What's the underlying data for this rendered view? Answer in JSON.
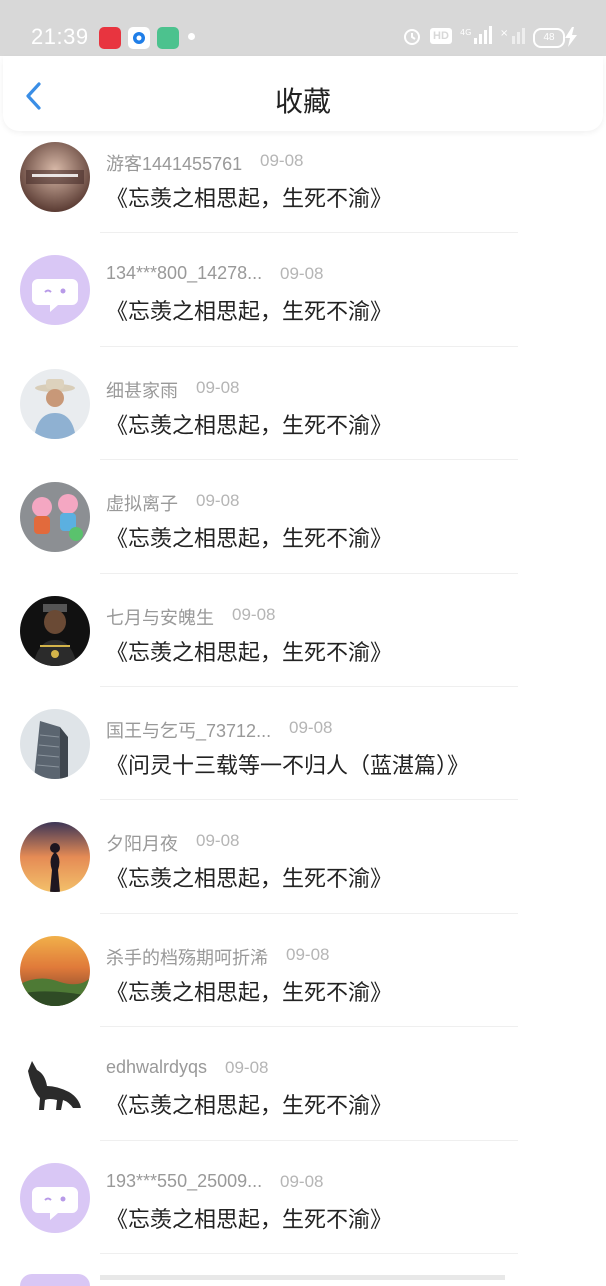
{
  "status_bar": {
    "time": "21:39",
    "hd_label": "HD",
    "battery": "48"
  },
  "header": {
    "title": "收藏"
  },
  "favorites": [
    {
      "user": "游客1441455761",
      "date": "09-08",
      "title": "《忘羡之相思起，生死不渝》",
      "avatar": "photo-dark-brown"
    },
    {
      "user": "134***800_14278...",
      "date": "09-08",
      "title": "《忘羡之相思起，生死不渝》",
      "avatar": "default-purple"
    },
    {
      "user": "细甚家雨",
      "date": "09-08",
      "title": "《忘羡之相思起，生死不渝》",
      "avatar": "photo-man-hat"
    },
    {
      "user": "虚拟离子",
      "date": "09-08",
      "title": "《忘羡之相思起，生死不渝》",
      "avatar": "photo-pig-toys"
    },
    {
      "user": "七月与安魄生",
      "date": "09-08",
      "title": "《忘羡之相思起，生死不渝》",
      "avatar": "photo-dark-figure"
    },
    {
      "user": "国王与乞丐_73712...",
      "date": "09-08",
      "title": "《问灵十三载等一不归人（蓝湛篇）》",
      "avatar": "photo-building"
    },
    {
      "user": "夕阳月夜",
      "date": "09-08",
      "title": "《忘羡之相思起，生死不渝》",
      "avatar": "photo-sunset"
    },
    {
      "user": "杀手的档殇期呵折浠",
      "date": "09-08",
      "title": "《忘羡之相思起，生死不渝》",
      "avatar": "photo-landscape"
    },
    {
      "user": "edhwalrdyqs",
      "date": "09-08",
      "title": "《忘羡之相思起，生死不渝》",
      "avatar": "photo-cat"
    },
    {
      "user": "193***550_25009...",
      "date": "09-08",
      "title": "《忘羡之相思起，生死不渝》",
      "avatar": "default-purple"
    }
  ],
  "colors": {
    "accent": "#3a8ee6",
    "status_bar": "#d8d8d8",
    "default_avatar": "#d9c7f5"
  }
}
